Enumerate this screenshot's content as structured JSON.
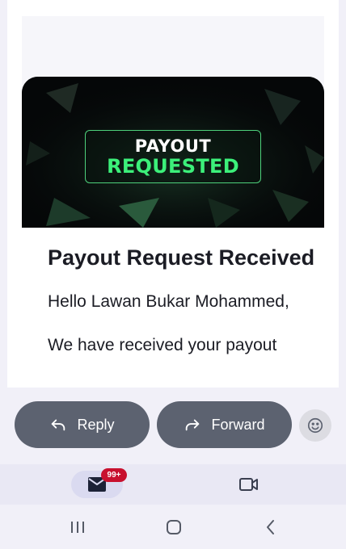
{
  "email": {
    "banner": {
      "line1": "PAYOUT",
      "line2": "REQUESTED"
    },
    "title": "Payout Request Received",
    "greeting": "Hello Lawan Bukar Mohammed,",
    "body_line": "We have received your payout"
  },
  "actions": {
    "reply_label": "Reply",
    "forward_label": "Forward"
  },
  "bottom_nav": {
    "mail_badge": "99+",
    "items": [
      "mail-icon",
      "video-camera-icon"
    ]
  },
  "system_nav": [
    "recents-icon",
    "home-icon",
    "back-icon"
  ],
  "colors": {
    "accent_green": "#3cf07a",
    "pill_bg": "#5c6270",
    "badge_red": "#c8102e"
  }
}
